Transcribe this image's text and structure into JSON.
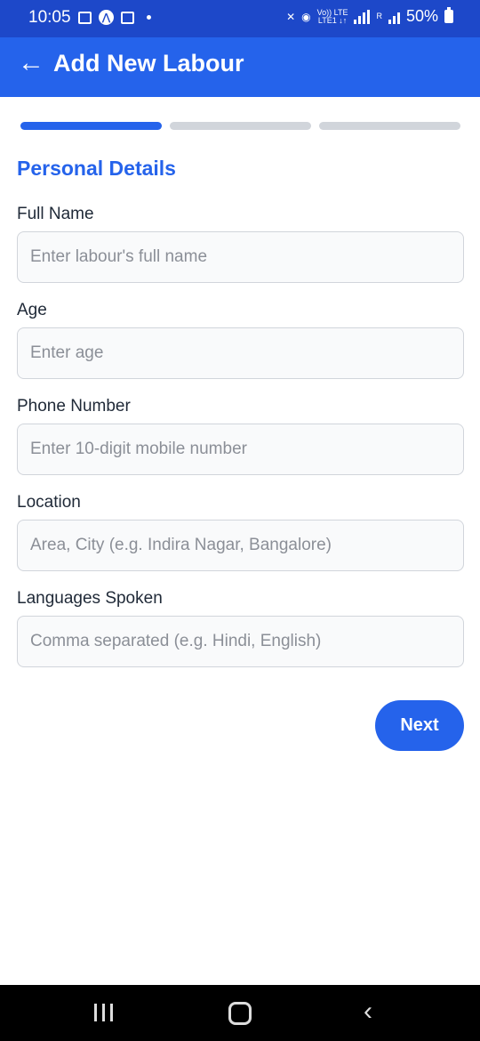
{
  "status_bar": {
    "time": "10:05",
    "lte_top": "Vo)) LTE",
    "lte_bottom": "LTE1 ↓↑",
    "roaming": "R",
    "battery": "50%"
  },
  "app_bar": {
    "back_icon": "arrow-left-icon",
    "title": "Add New Labour"
  },
  "progress": {
    "total_steps": 3,
    "current_step": 1
  },
  "section_title": "Personal Details",
  "fields": [
    {
      "label": "Full Name",
      "placeholder": "Enter labour's full name",
      "value": ""
    },
    {
      "label": "Age",
      "placeholder": "Enter age",
      "value": ""
    },
    {
      "label": "Phone Number",
      "placeholder": "Enter 10-digit mobile number",
      "value": ""
    },
    {
      "label": "Location",
      "placeholder": "Area, City (e.g. Indira Nagar, Bangalore)",
      "value": ""
    },
    {
      "label": "Languages Spoken",
      "placeholder": "Comma separated (e.g. Hindi, English)",
      "value": ""
    }
  ],
  "next_button": "Next",
  "colors": {
    "primary": "#2563eb",
    "status_bar": "#1d48c9",
    "inactive_step": "#d1d5db"
  }
}
